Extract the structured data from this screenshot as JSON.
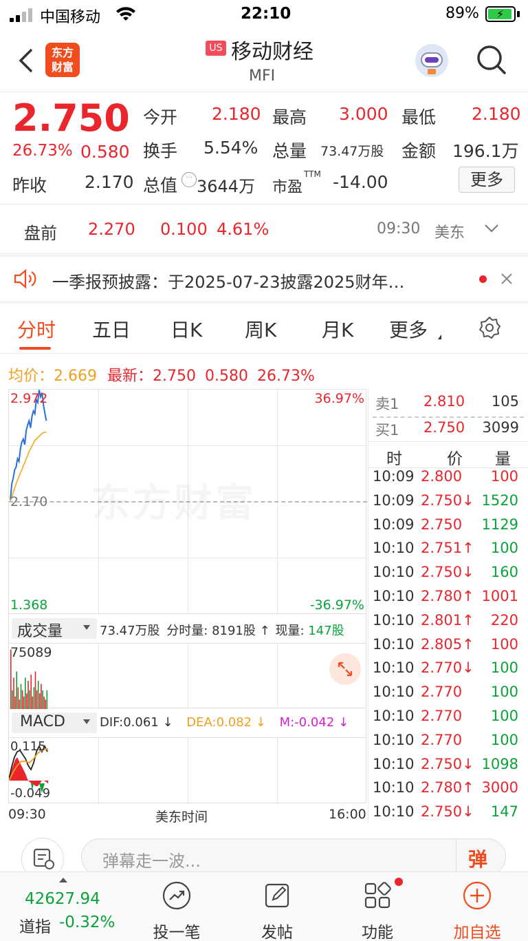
{
  "status": {
    "carrier": "中国移动",
    "time": "22:10",
    "battery": "89%"
  },
  "header": {
    "market_badge": "US",
    "title": "移动财经",
    "symbol": "MFI",
    "logo_line1": "东方",
    "logo_line2": "财富"
  },
  "quote": {
    "price": "2.750",
    "change_pct": "26.73%",
    "change": "0.580",
    "prev_close_label": "昨收",
    "prev_close": "2.170",
    "open_label": "今开",
    "open": "2.180",
    "turnover_label": "换手",
    "turnover": "5.54%",
    "mktcap_label": "总值",
    "mktcap": "3644万",
    "high_label": "最高",
    "high": "3.000",
    "volume_label": "总量",
    "volume": "73.47万股",
    "pe_label": "市盈",
    "pe_sup": "TTM",
    "pe": "-14.00",
    "low_label": "最低",
    "low": "2.180",
    "amount_label": "金额",
    "amount": "196.1万",
    "more_button": "更多"
  },
  "premarket": {
    "label": "盘前",
    "price": "2.270",
    "change": "0.100",
    "pct": "4.61%",
    "time": "09:30",
    "tz": "美东"
  },
  "notice": {
    "text": "一季报预披露：于2025-07-23披露2025财年…"
  },
  "tabs": [
    "分时",
    "五日",
    "日K",
    "周K",
    "月K",
    "更多"
  ],
  "chart_info": {
    "avg_label": "均价：",
    "avg": "2.669",
    "latest_label": "最新：",
    "latest": "2.750",
    "change": "0.580",
    "pct": "26.73%"
  },
  "chart_data": {
    "type": "line",
    "y_ticks": {
      "top": "2.972",
      "mid": "2.170",
      "bottom": "1.368"
    },
    "pct_ticks": {
      "top": "36.97%",
      "bottom": "-36.97%"
    },
    "watermark": "东方财富",
    "x_labels": {
      "start": "09:30",
      "mid": "美东时间",
      "end": "16:00"
    },
    "series": [
      {
        "name": "价格",
        "color": "#2b6fd6",
        "values": [
          2.18,
          2.3,
          2.34,
          2.4,
          2.42,
          2.48,
          2.46,
          2.55,
          2.6,
          2.62,
          2.58,
          2.68,
          2.72,
          2.75,
          2.7,
          2.78,
          2.82,
          2.8,
          2.9,
          2.88,
          2.97,
          2.92,
          2.95,
          2.86,
          2.8,
          2.75
        ]
      },
      {
        "name": "均价",
        "color": "#f0b030",
        "values": [
          2.18,
          2.2,
          2.24,
          2.27,
          2.3,
          2.33,
          2.35,
          2.38,
          2.4,
          2.43,
          2.45,
          2.48,
          2.5,
          2.53,
          2.55,
          2.57,
          2.59,
          2.61,
          2.62,
          2.63,
          2.64,
          2.65,
          2.66,
          2.665,
          2.668,
          2.669
        ]
      }
    ],
    "volume_max_label": "75089",
    "volume_bars": [
      0.95,
      0.3,
      0.5,
      0.2,
      0.6,
      0.35,
      0.15,
      0.4,
      0.3,
      0.2,
      0.5,
      0.25,
      0.45,
      0.3,
      0.55,
      0.2,
      0.35,
      0.6,
      0.3,
      0.45,
      0.25,
      0.4,
      0.3,
      0.2,
      0.15,
      0.3
    ],
    "macd": {
      "top": "0.115",
      "bottom": "-0.049"
    }
  },
  "volume_panel": {
    "selector": "成交量",
    "total": "73.47万股",
    "tick_label": "分时量:",
    "tick_vol": "8191股",
    "cur_label": "现量:",
    "cur_vol": "147股"
  },
  "macd_panel": {
    "selector": "MACD",
    "dif": "DIF:0.061",
    "dea": "DEA:0.082",
    "m": "M:-0.042"
  },
  "orderbook": {
    "ask_label": "卖1",
    "ask_price": "2.810",
    "ask_vol": "105",
    "bid_label": "买1",
    "bid_price": "2.750",
    "bid_vol": "3099"
  },
  "ticks_header": {
    "time": "时",
    "price": "价",
    "vol": "量"
  },
  "ticks": [
    {
      "time": "10:09",
      "price": "2.800",
      "arrow": "",
      "vol": "100",
      "pc": "red",
      "vc": "red"
    },
    {
      "time": "10:09",
      "price": "2.750↓",
      "arrow": "",
      "vol": "1520",
      "pc": "red",
      "vc": "green"
    },
    {
      "time": "10:09",
      "price": "2.750",
      "arrow": "",
      "vol": "1129",
      "pc": "red",
      "vc": "green"
    },
    {
      "time": "10:10",
      "price": "2.751↑",
      "arrow": "",
      "vol": "100",
      "pc": "red",
      "vc": "green"
    },
    {
      "time": "10:10",
      "price": "2.750↓",
      "arrow": "",
      "vol": "160",
      "pc": "red",
      "vc": "green"
    },
    {
      "time": "10:10",
      "price": "2.780↑",
      "arrow": "",
      "vol": "1001",
      "pc": "red",
      "vc": "red"
    },
    {
      "time": "10:10",
      "price": "2.801↑",
      "arrow": "",
      "vol": "220",
      "pc": "red",
      "vc": "red"
    },
    {
      "time": "10:10",
      "price": "2.805↑",
      "arrow": "",
      "vol": "100",
      "pc": "red",
      "vc": "red"
    },
    {
      "time": "10:10",
      "price": "2.770↓",
      "arrow": "",
      "vol": "100",
      "pc": "red",
      "vc": "green"
    },
    {
      "time": "10:10",
      "price": "2.770",
      "arrow": "",
      "vol": "100",
      "pc": "red",
      "vc": "green"
    },
    {
      "time": "10:10",
      "price": "2.770",
      "arrow": "",
      "vol": "100",
      "pc": "red",
      "vc": "green"
    },
    {
      "time": "10:10",
      "price": "2.770",
      "arrow": "",
      "vol": "100",
      "pc": "red",
      "vc": "green"
    },
    {
      "time": "10:10",
      "price": "2.750↓",
      "arrow": "",
      "vol": "1098",
      "pc": "red",
      "vc": "green"
    },
    {
      "time": "10:10",
      "price": "2.780↑",
      "arrow": "",
      "vol": "3000",
      "pc": "red",
      "vc": "red"
    },
    {
      "time": "10:10",
      "price": "2.750↓",
      "arrow": "",
      "vol": "147",
      "pc": "red",
      "vc": "green"
    }
  ],
  "comment": {
    "placeholder": "弹幕走一波...",
    "danmu": "弹"
  },
  "bottom": {
    "index_value": "42627.94",
    "index_name": "道指",
    "index_pct": "-0.32%",
    "nav": [
      "投一笔",
      "发帖",
      "功能",
      "加自选"
    ]
  }
}
